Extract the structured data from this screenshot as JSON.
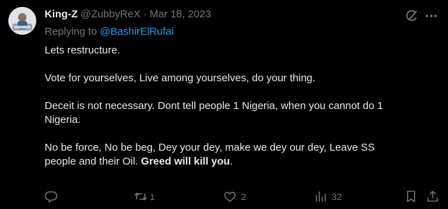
{
  "tweet": {
    "display_name": "King-Z",
    "handle": "@ZubbyReX",
    "separator": "·",
    "date": "Mar 18, 2023",
    "replying_prefix": "Replying to ",
    "replying_to": "@BashirElRufai",
    "body": {
      "line1": "Lets restructure.",
      "line2": "Vote for yourselves, Live among yourselves, do your thing.",
      "line3a": "Deceit is not necessary. Dont tell people 1 Nigeria, when you cannot do 1",
      "line3b": "Nigeria.",
      "line4a": "No be force, No be beg, Dey your dey, make we dey our dey, Leave SS",
      "line4b_plain": "people and their Oil. ",
      "line4b_bold": "Greed will kill you",
      "line4b_end": "."
    }
  },
  "actions": {
    "reply_count": "",
    "retweet_count": "1",
    "like_count": "2",
    "views_count": "32"
  },
  "icons": {
    "avatar": "avatar-image",
    "grok": "grok-icon",
    "more": "more-options-icon",
    "reply": "reply-icon",
    "retweet": "retweet-icon",
    "like": "heart-icon",
    "views": "views-chart-icon",
    "bookmark": "bookmark-icon",
    "share": "share-icon"
  },
  "colors": {
    "background": "#000000",
    "text": "#e7e9ea",
    "muted": "#71767b",
    "link": "#1d9bf0"
  }
}
